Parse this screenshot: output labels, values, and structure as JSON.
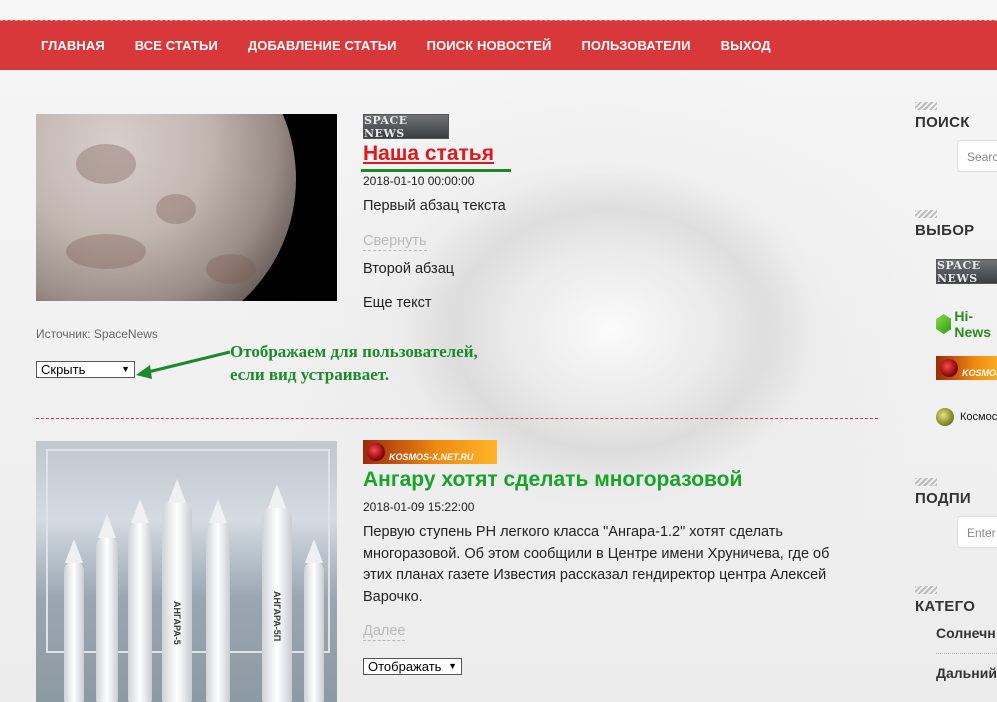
{
  "nav": {
    "items": [
      "ГЛАВНАЯ",
      "ВСЕ СТАТЬИ",
      "ДОБАВЛЕНИЕ СТАТЬИ",
      "ПОИСК НОВОСТЕЙ",
      "ПОЛЬЗОВАТЕЛИ",
      "ВЫХОД"
    ]
  },
  "article1": {
    "source_logo": "SPACE NEWS",
    "title": "Наша статья",
    "date": "2018-01-10 00:00:00",
    "paragraph1": "Первый абзац текста",
    "collapse_link": "Свернуть",
    "paragraph2": "Второй абзац",
    "paragraph3": "Еще текст",
    "source_text": "Источник: SpaceNews",
    "visibility_select": "Скрыть"
  },
  "annotation": {
    "line1": "Отображаем для пользователей,",
    "line2": "если вид устраивает."
  },
  "article2": {
    "source_logo": "KOSMOS-X.NET.RU",
    "title": "Ангару хотят сделать многоразовой",
    "date": "2018-01-09 15:22:00",
    "paragraph": "Первую ступень РН легкого класса \"Ангара-1.2\" хотят сделать многоразовой. Об этом сообщили в Центре имени Хруничева, где об этих планах газете Известия рассказал гендиректор центра Алексей Варочко.",
    "more_link": "Далее",
    "visibility_select": "Отображать",
    "rocket_labels": [
      "АНГАРА-5",
      "АНГАРА-5П"
    ]
  },
  "sidebar": {
    "search_heading": "ПОИСК",
    "search_placeholder": "Search",
    "select_heading": "ВЫБОР",
    "sources": [
      "SPACE NEWS",
      "Hi-News",
      "KOSMOS",
      "Космос"
    ],
    "subscribe_heading": "ПОДПИ",
    "subscribe_placeholder": "Enter",
    "categories_heading": "КАТЕГО",
    "categories": [
      "Солнечн",
      "Дальний"
    ]
  },
  "colors": {
    "nav_bg": "#d9383a",
    "title_red": "#e0181c",
    "title_green": "#18a32a",
    "annotation": "#1c8a2a"
  }
}
